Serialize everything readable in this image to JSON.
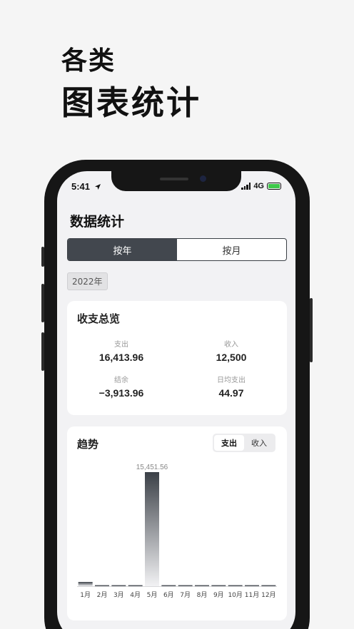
{
  "headline": {
    "line1": "各类",
    "line2": "图表统计"
  },
  "status": {
    "time": "5:41",
    "network": "4G"
  },
  "page": {
    "title": "数据统计"
  },
  "segment": {
    "items": [
      "按年",
      "按月"
    ],
    "active": 0
  },
  "year": "2022年",
  "overview": {
    "title": "收支总览",
    "expense_label": "支出",
    "expense_value": "16,413.96",
    "income_label": "收入",
    "income_value": "12,500",
    "balance_label": "结余",
    "balance_value": "−3,913.96",
    "daily_label": "日均支出",
    "daily_value": "44.97"
  },
  "trend": {
    "title": "趋势",
    "toggle": [
      "支出",
      "收入"
    ],
    "active": 0
  },
  "chart_data": {
    "type": "bar",
    "categories": [
      "1月",
      "2月",
      "3月",
      "4月",
      "5月",
      "6月",
      "7月",
      "8月",
      "9月",
      "10月",
      "11月",
      "12月"
    ],
    "values": [
      580,
      60,
      40,
      70,
      15451.56,
      20,
      70,
      30,
      20,
      20,
      20,
      20
    ],
    "annotations": [
      {
        "category": "5月",
        "text": "15,451.56"
      }
    ],
    "ylim": [
      0,
      15451.56
    ],
    "colors": {
      "bar_top": "#3b4047",
      "bar_bottom": "#f2f2f4"
    }
  }
}
